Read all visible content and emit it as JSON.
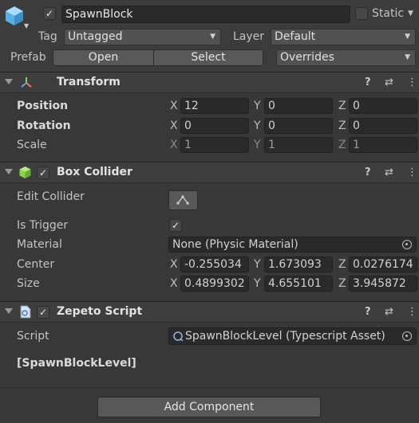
{
  "header": {
    "object_name": "SpawnBlock",
    "static_label": "Static",
    "tag_label": "Tag",
    "tag_value": "Untagged",
    "layer_label": "Layer",
    "layer_value": "Default",
    "prefab_label": "Prefab",
    "open_label": "Open",
    "select_label": "Select",
    "overrides_label": "Overrides",
    "active": true
  },
  "transform": {
    "title": "Transform",
    "position_label": "Position",
    "rotation_label": "Rotation",
    "scale_label": "Scale",
    "position": {
      "x": "12",
      "y": "0",
      "z": "0"
    },
    "rotation": {
      "x": "0",
      "y": "0",
      "z": "0"
    },
    "scale": {
      "x": "1",
      "y": "1",
      "z": "1"
    }
  },
  "box_collider": {
    "title": "Box Collider",
    "enabled": true,
    "edit_collider_label": "Edit Collider",
    "is_trigger_label": "Is Trigger",
    "is_trigger": true,
    "material_label": "Material",
    "material_value": "None (Physic Material)",
    "center_label": "Center",
    "center": {
      "x": "-0.255034",
      "y": "1.673093",
      "z": "0.0276174"
    },
    "size_label": "Size",
    "size": {
      "x": "0.4899302",
      "y": "4.655101",
      "z": "3.945872"
    }
  },
  "zepeto_script": {
    "title": "Zepeto Script",
    "enabled": true,
    "script_label": "Script",
    "script_value": "SpawnBlockLevel (Typescript Asset)",
    "class_label": "[SpawnBlockLevel]"
  },
  "axes": {
    "x": "X",
    "y": "Y",
    "z": "Z"
  },
  "add_component_label": "Add Component",
  "colors": {
    "background": "#383838",
    "header": "#3e3e3e",
    "field": "#2a2a2a",
    "cube_icon": "#7fc2f0",
    "collider_icon": "#8fd14f"
  }
}
